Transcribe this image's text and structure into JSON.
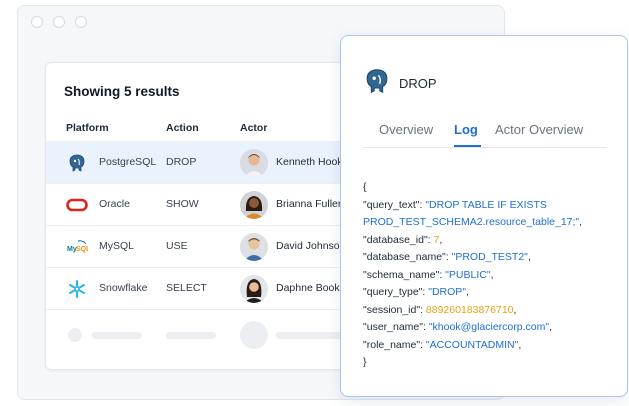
{
  "results": {
    "title": "Showing 5 results",
    "columns": [
      "Platform",
      "Action",
      "Actor"
    ],
    "rows": [
      {
        "platform": "PostgreSQL",
        "icon": "postgresql-icon",
        "action": "DROP",
        "actor": "Kenneth Hooks"
      },
      {
        "platform": "Oracle",
        "icon": "oracle-icon",
        "action": "SHOW",
        "actor": "Brianna Fuller"
      },
      {
        "platform": "MySQL",
        "icon": "mysql-icon",
        "action": "USE",
        "actor": "David Johnson"
      },
      {
        "platform": "Snowflake",
        "icon": "snowflake-icon",
        "action": "SELECT",
        "actor": "Daphne Booker"
      }
    ]
  },
  "detail": {
    "title": "DROP",
    "icon": "postgresql-icon",
    "tabs": [
      "Overview",
      "Log",
      "Actor Overview"
    ],
    "active_tab": "Log",
    "log": {
      "open": "{",
      "close": "}",
      "entries": [
        {
          "key": "\"query_text\": ",
          "value": "\"DROP TABLE IF EXISTS PROD_TEST_SCHEMA2.resource_table_17;\"",
          "type": "string"
        },
        {
          "key": "\"database_id\": ",
          "value": "7",
          "type": "number"
        },
        {
          "key": "\"database_name\": ",
          "value": "\"PROD_TEST2\"",
          "type": "string"
        },
        {
          "key": "\"schema_name\": ",
          "value": "\"PUBLIC\"",
          "type": "string"
        },
        {
          "key": "\"query_type\": ",
          "value": "\"DROP\"",
          "type": "string"
        },
        {
          "key": "\"session_id\": ",
          "value": "889260183876710",
          "type": "number"
        },
        {
          "key": "\"user_name\": ",
          "value": "\"khook@glaciercorp.com\"",
          "type": "string"
        },
        {
          "key": "\"role_name\": ",
          "value": "\"ACCOUNTADMIN\"",
          "type": "string"
        }
      ]
    }
  },
  "colors": {
    "accent": "#1d6fd6",
    "number": "#e8a317",
    "selected_row": "#eaf2fd",
    "panel_border": "#a9c6ee"
  }
}
